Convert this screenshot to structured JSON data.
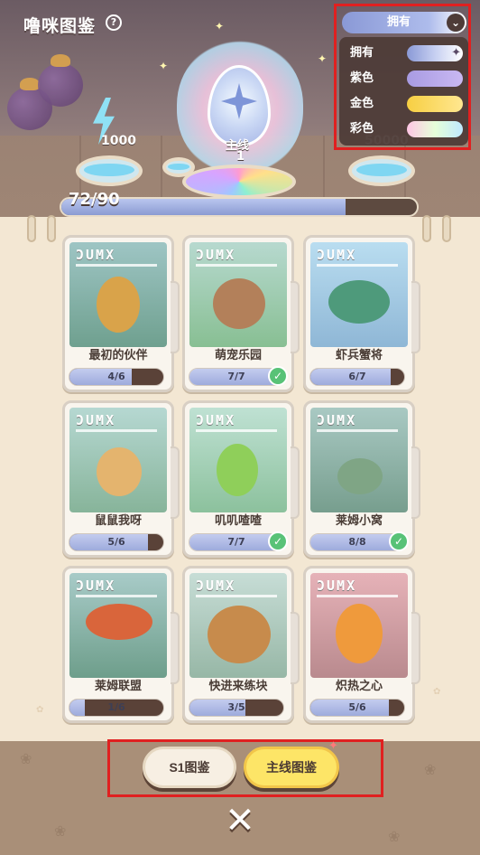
{
  "header": {
    "title": "噜咪图鉴",
    "help": "?"
  },
  "scene": {
    "energy_value": "1000",
    "egg_label": "主线",
    "egg_count": "1",
    "coins_value": "50000",
    "progress_text": "72/90",
    "progress_fraction": 0.8
  },
  "filter": {
    "selected": "拥有",
    "chevron": "⌄",
    "options": [
      {
        "label": "拥有",
        "color": "owned",
        "icon": "✦"
      },
      {
        "label": "紫色",
        "color": "purple"
      },
      {
        "label": "金色",
        "color": "gold"
      },
      {
        "label": "彩色",
        "color": "rainbow"
      }
    ]
  },
  "brand": "ƆUMX",
  "cards": [
    {
      "name": "最初的伙伴",
      "progress": "4/6",
      "fraction": 0.667,
      "complete": false
    },
    {
      "name": "萌宠乐园",
      "progress": "7/7",
      "fraction": 1.0,
      "complete": true
    },
    {
      "name": "虾兵蟹将",
      "progress": "6/7",
      "fraction": 0.857,
      "complete": false
    },
    {
      "name": "鼠鼠我呀",
      "progress": "5/6",
      "fraction": 0.833,
      "complete": false
    },
    {
      "name": "叽叽喳喳",
      "progress": "7/7",
      "fraction": 1.0,
      "complete": true
    },
    {
      "name": "莱姆小窝",
      "progress": "8/8",
      "fraction": 1.0,
      "complete": true
    },
    {
      "name": "莱姆联盟",
      "progress": "1/6",
      "fraction": 0.167,
      "complete": false
    },
    {
      "name": "快进来练块",
      "progress": "3/5",
      "fraction": 0.6,
      "complete": false
    },
    {
      "name": "炽热之心",
      "progress": "5/6",
      "fraction": 0.833,
      "complete": false
    }
  ],
  "footer": {
    "s1_label": "S1图鉴",
    "main_label": "主线图鉴",
    "close": "✕"
  },
  "colors": {
    "accent_yellow": "#fde567",
    "highlight_red": "#e02020",
    "check_green": "#58c277"
  }
}
